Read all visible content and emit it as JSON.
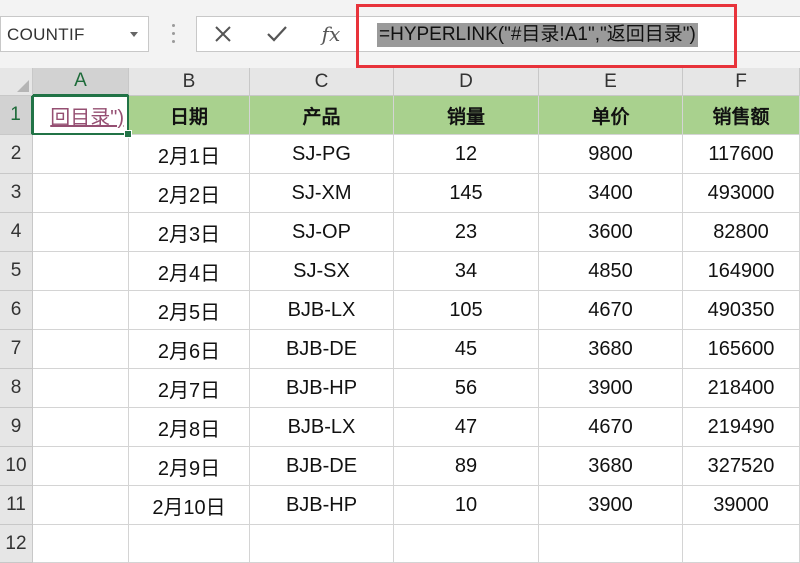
{
  "name_box": {
    "value": "COUNTIF"
  },
  "formula_bar": {
    "cancel_icon": "cancel-x-icon",
    "enter_icon": "checkmark-icon",
    "function_label": "fx",
    "formula": "=HYPERLINK(\"#目录!A1\",\"返回目录\")"
  },
  "columns": [
    "A",
    "B",
    "C",
    "D",
    "E",
    "F"
  ],
  "rows": [
    "1",
    "2",
    "3",
    "4",
    "5",
    "6",
    "7",
    "8",
    "9",
    "10",
    "11",
    "12"
  ],
  "a1_display": "回目录\")",
  "table": {
    "headers": [
      "日期",
      "产品",
      "销量",
      "单价",
      "销售额"
    ],
    "rows": [
      [
        "2月1日",
        "SJ-PG",
        "12",
        "9800",
        "117600"
      ],
      [
        "2月2日",
        "SJ-XM",
        "145",
        "3400",
        "493000"
      ],
      [
        "2月3日",
        "SJ-OP",
        "23",
        "3600",
        "82800"
      ],
      [
        "2月4日",
        "SJ-SX",
        "34",
        "4850",
        "164900"
      ],
      [
        "2月5日",
        "BJB-LX",
        "105",
        "4670",
        "490350"
      ],
      [
        "2月6日",
        "BJB-DE",
        "45",
        "3680",
        "165600"
      ],
      [
        "2月7日",
        "BJB-HP",
        "56",
        "3900",
        "218400"
      ],
      [
        "2月8日",
        "BJB-LX",
        "47",
        "4670",
        "219490"
      ],
      [
        "2月9日",
        "BJB-DE",
        "89",
        "3680",
        "327520"
      ],
      [
        "2月10日",
        "BJB-HP",
        "10",
        "3900",
        "39000"
      ]
    ]
  },
  "colors": {
    "header_fill": "#a9d18e",
    "selection": "#217346",
    "annotation": "#e8333b",
    "link": "#954f72"
  }
}
